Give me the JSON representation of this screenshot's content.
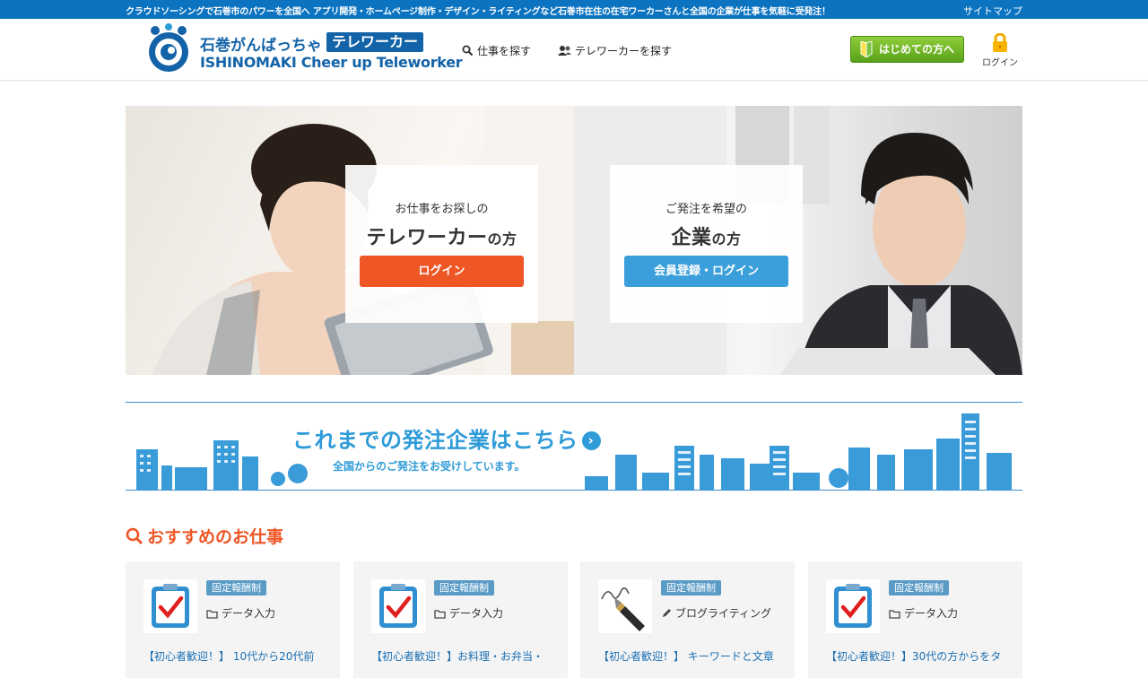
{
  "topbar": {
    "tagline": "クラウドソーシングで石巻市のパワーを全国へ アプリ開発・ホームページ制作・デザイン・ライティングなど石巻市在住の在宅ワーカーさんと全国の企業が仕事を気軽に受発注！",
    "sitemap": "サイトマップ"
  },
  "header": {
    "logo_jp": "石巻がんばっちゃ",
    "logo_jp_box": "テレワーカー",
    "logo_en": "ISHINOMAKI  Cheer up Teleworker",
    "nav": {
      "jobs": "仕事を探す",
      "workers": "テレワーカーを探す"
    },
    "beginner_button": "はじめての方へ",
    "login": "ログイン"
  },
  "hero": {
    "left": {
      "lead": "お仕事をお探しの",
      "main": "テレワーカー",
      "suffix": "の方",
      "button": "ログイン"
    },
    "right": {
      "lead": "ご発注を希望の",
      "main": "企業",
      "suffix": "の方",
      "button": "会員登録・ログイン"
    }
  },
  "banner": {
    "title": "これまでの発注企業はこちら",
    "subtitle": "全国からのご発注をお受けしています。"
  },
  "section": {
    "title": "おすすめのお仕事"
  },
  "jobs": [
    {
      "badge": "固定報酬制",
      "category": "データ入力",
      "icon": "checklist-icon",
      "title": "【初心者歓迎！】 10代から20代前"
    },
    {
      "badge": "固定報酬制",
      "category": "データ入力",
      "icon": "checklist-icon",
      "title": "【初心者歓迎！】お料理・お弁当・"
    },
    {
      "badge": "固定報酬制",
      "category": "ブログライティング",
      "icon": "fountain-pen-icon",
      "title": "【初心者歓迎！】 キーワードと文章"
    },
    {
      "badge": "固定報酬制",
      "category": "データ入力",
      "icon": "checklist-icon",
      "title": "【初心者歓迎！】30代の方からをタ"
    }
  ],
  "colors": {
    "topbar": "#0b73bf",
    "brand_blue": "#1363a8",
    "accent_orange": "#ee5626",
    "button_blue": "#3b9fdb",
    "beginner_green": "#6bb323",
    "badge_blue": "#5a9bc6"
  }
}
